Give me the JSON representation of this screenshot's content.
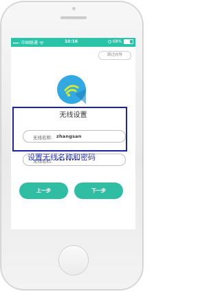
{
  "status_bar": {
    "carrier": "中国联通",
    "time": "10:16",
    "battery_percent": "68%",
    "battery_level": 0.68
  },
  "skip_button": {
    "label": "跳过向导"
  },
  "page": {
    "title": "无线设置"
  },
  "form": {
    "ssid_label": "无线名称:",
    "ssid_value": "zhangsan",
    "password_label": "无线密码:",
    "password_value": "••••••••"
  },
  "annotation": {
    "caption": "设置无线名称和密码"
  },
  "buttons": {
    "prev_label": "上一步",
    "next_label": "下一步"
  },
  "colors": {
    "accent": "#2fbea3",
    "status_bar": "#29c3a8",
    "logo": "#32a9e0",
    "annotation": "#1b24a8"
  }
}
